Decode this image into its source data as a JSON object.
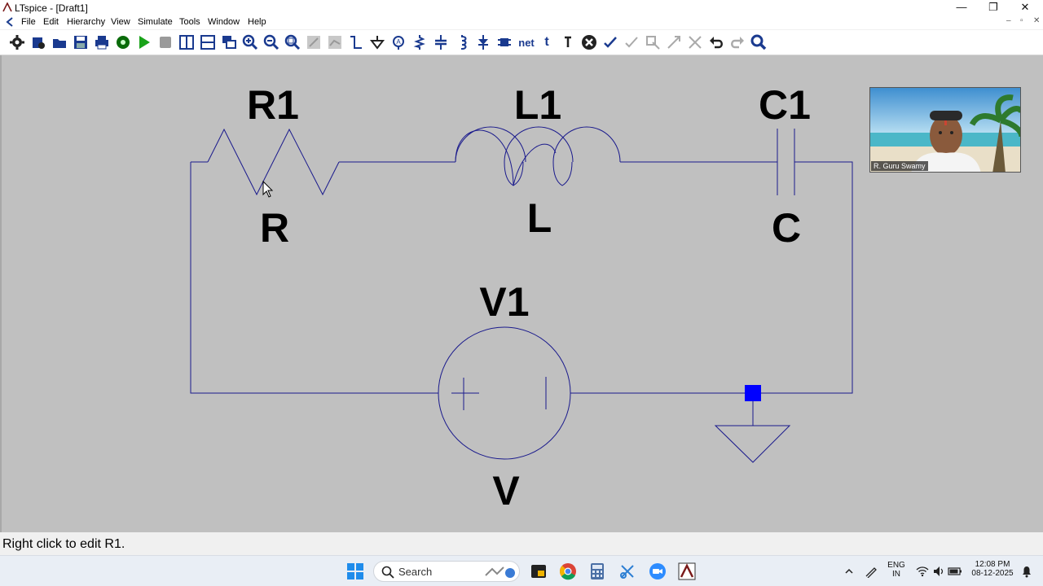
{
  "window": {
    "title": "LTspice - [Draft1]",
    "controls": {
      "minimize": "—",
      "maximize": "❐",
      "close": "✕"
    },
    "mdi_controls": {
      "minimize": "–",
      "restore": "▫",
      "close": "✕"
    }
  },
  "menu": {
    "items": [
      "File",
      "Edit",
      "Hierarchy",
      "View",
      "Simulate",
      "Tools",
      "Window",
      "Help"
    ]
  },
  "toolbar": {
    "net_label": "net",
    "t_label": "t"
  },
  "schematic": {
    "components": [
      {
        "ref": "R1",
        "value": "R"
      },
      {
        "ref": "L1",
        "value": "L"
      },
      {
        "ref": "C1",
        "value": "C"
      },
      {
        "ref": "V1",
        "value": "V"
      }
    ],
    "wire_color": "#1a1a8c",
    "junction_color": "#0000ff"
  },
  "video": {
    "participant": "R. Guru Swamy"
  },
  "status": {
    "text": "Right click to edit R1."
  },
  "taskbar": {
    "search_placeholder": "Search",
    "lang_top": "ENG",
    "lang_bottom": "IN",
    "time": "12:08 PM",
    "date": "08-12-2025"
  }
}
